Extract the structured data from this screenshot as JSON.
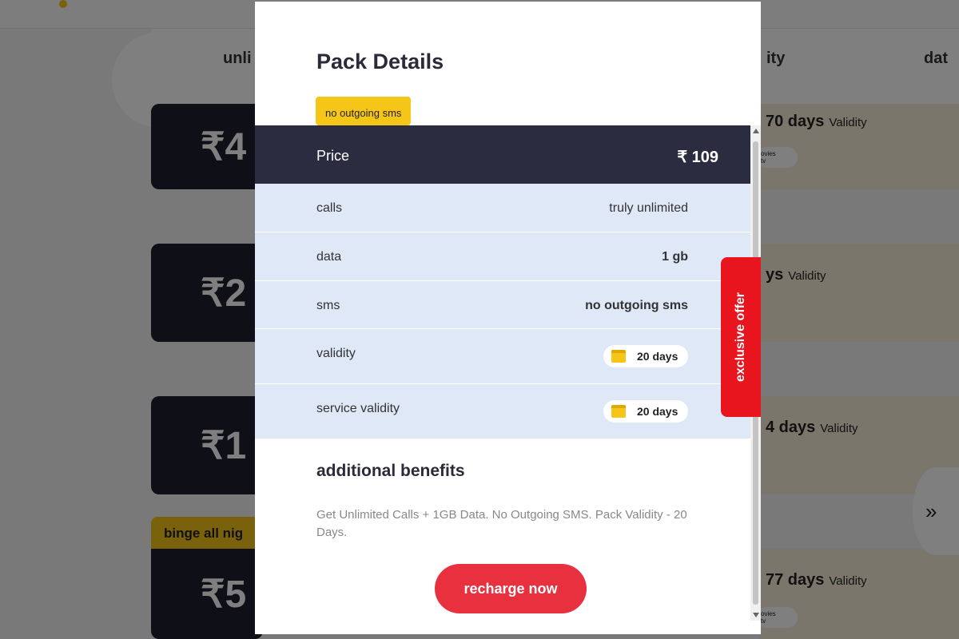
{
  "background": {
    "header_labels": [
      "unli",
      "ity",
      "dat"
    ],
    "price_cards": [
      "₹4",
      "₹2",
      "₹1",
      "₹5"
    ],
    "validity_rows": [
      {
        "days": "70 days",
        "suffix": "Validity",
        "ott": "ovies\ntv"
      },
      {
        "days": "ys",
        "suffix": "Validity"
      },
      {
        "days": "4 days",
        "suffix": "Validity"
      },
      {
        "days": "77 days",
        "suffix": "Validity",
        "ott": "ovies\ntv"
      }
    ],
    "binge_tag": "binge all nig",
    "next_icon": "»"
  },
  "modal": {
    "title": "Pack Details",
    "tag": "no outgoing sms",
    "price": {
      "label": "Price",
      "value": "₹ 109"
    },
    "details": [
      {
        "label": "calls",
        "value": "truly unlimited"
      },
      {
        "label": "data",
        "value": "1 gb"
      },
      {
        "label": "sms",
        "value": "no outgoing sms"
      },
      {
        "label": "validity",
        "value": "20 days",
        "icon": "calendar-icon"
      },
      {
        "label": "service validity",
        "value": "20 days",
        "icon": "calendar-icon"
      }
    ],
    "benefits": {
      "title": "additional benefits",
      "text": "Get Unlimited Calls + 1GB Data. No Outgoing SMS. Pack Validity - 20 Days."
    },
    "cta": "recharge now"
  },
  "exclusive_tab": "exclusive offer",
  "colors": {
    "accent_red": "#e8303f",
    "tag_yellow": "#f5c518",
    "dark_row": "#2b2c3f",
    "detail_row": "#dfe8f7"
  }
}
